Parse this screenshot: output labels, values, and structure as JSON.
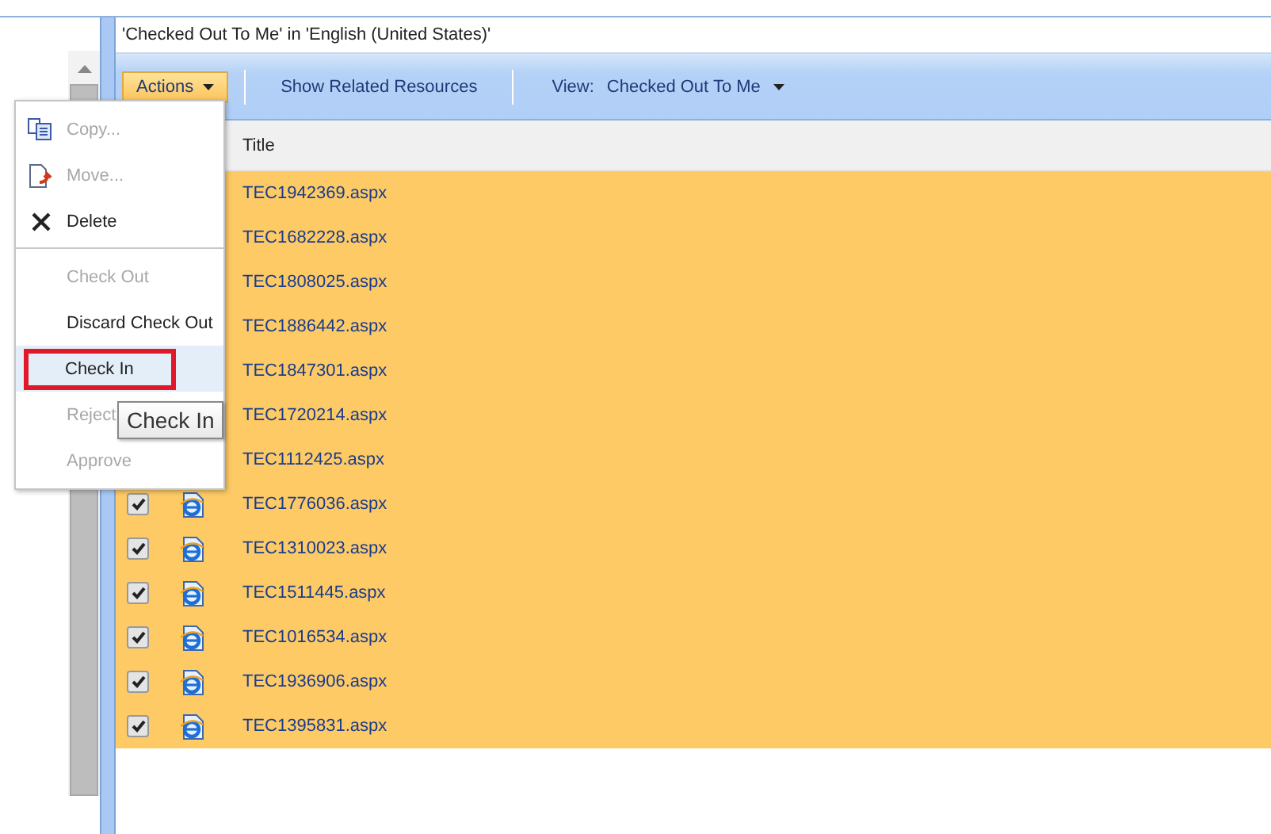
{
  "header": {
    "title": "'Checked Out To Me' in 'English (United States)'"
  },
  "toolbar": {
    "actions": "Actions",
    "related": "Show Related Resources",
    "view_label": "View:",
    "view_value": "Checked Out To Me"
  },
  "table": {
    "columns": [
      "Title"
    ],
    "rows": [
      {
        "title": "TEC1942369.aspx"
      },
      {
        "title": "TEC1682228.aspx"
      },
      {
        "title": "TEC1808025.aspx"
      },
      {
        "title": "TEC1886442.aspx"
      },
      {
        "title": "TEC1847301.aspx"
      },
      {
        "title": "TEC1720214.aspx"
      },
      {
        "title": "TEC1112425.aspx"
      },
      {
        "title": "TEC1776036.aspx",
        "checked": true
      },
      {
        "title": "TEC1310023.aspx",
        "checked": true
      },
      {
        "title": "TEC1511445.aspx",
        "checked": true
      },
      {
        "title": "TEC1016534.aspx",
        "checked": true
      },
      {
        "title": "TEC1936906.aspx",
        "checked": true
      },
      {
        "title": "TEC1395831.aspx",
        "checked": true
      }
    ]
  },
  "menu": {
    "groups": [
      [
        {
          "label": "Copy...",
          "kind": "copy",
          "disabled": true,
          "selected": false
        },
        {
          "label": "Move...",
          "kind": "move",
          "disabled": true,
          "selected": false
        },
        {
          "label": "Delete",
          "kind": "delete",
          "disabled": false,
          "selected": false
        }
      ],
      [
        {
          "label": "Check Out",
          "kind": "plain",
          "disabled": true,
          "selected": false
        },
        {
          "label": "Discard Check Out",
          "kind": "plain",
          "disabled": false,
          "selected": false
        },
        {
          "label": "Check In",
          "kind": "plain",
          "disabled": false,
          "selected": true
        },
        {
          "label": "Reject",
          "kind": "plain",
          "disabled": true,
          "selected": false
        },
        {
          "label": "Approve",
          "kind": "plain",
          "disabled": true,
          "selected": false
        }
      ]
    ]
  },
  "tooltip": {
    "text": "Check In"
  }
}
